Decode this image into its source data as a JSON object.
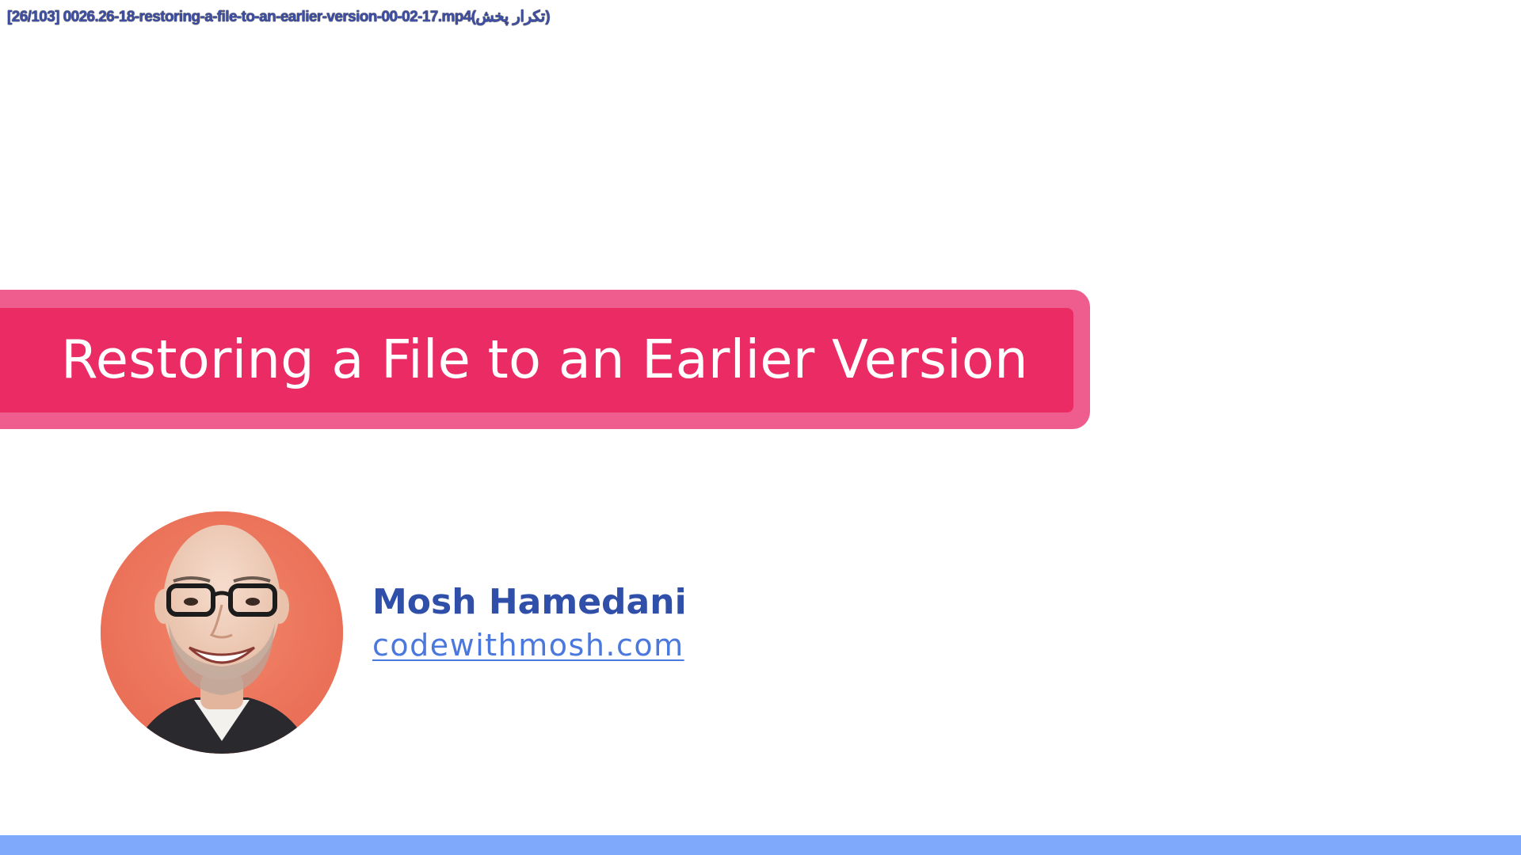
{
  "player": {
    "caption": "[26/103] 0026.26-18-restoring-a-file-to-an-earlier-version-00-02-17.mp4(تکرار پخش)"
  },
  "slide": {
    "title": "Restoring a File to an Earlier Version",
    "author": {
      "name": "Mosh Hamedani",
      "website": "codewithmosh.com"
    }
  },
  "colors": {
    "banner_outer": "#ee5d8e",
    "banner_inner": "#eb2b63",
    "author_name": "#2f4fa8",
    "website_link": "#4a78dd",
    "bottom_bar": "#7fa9fb",
    "avatar_background": "#ee7a60"
  }
}
